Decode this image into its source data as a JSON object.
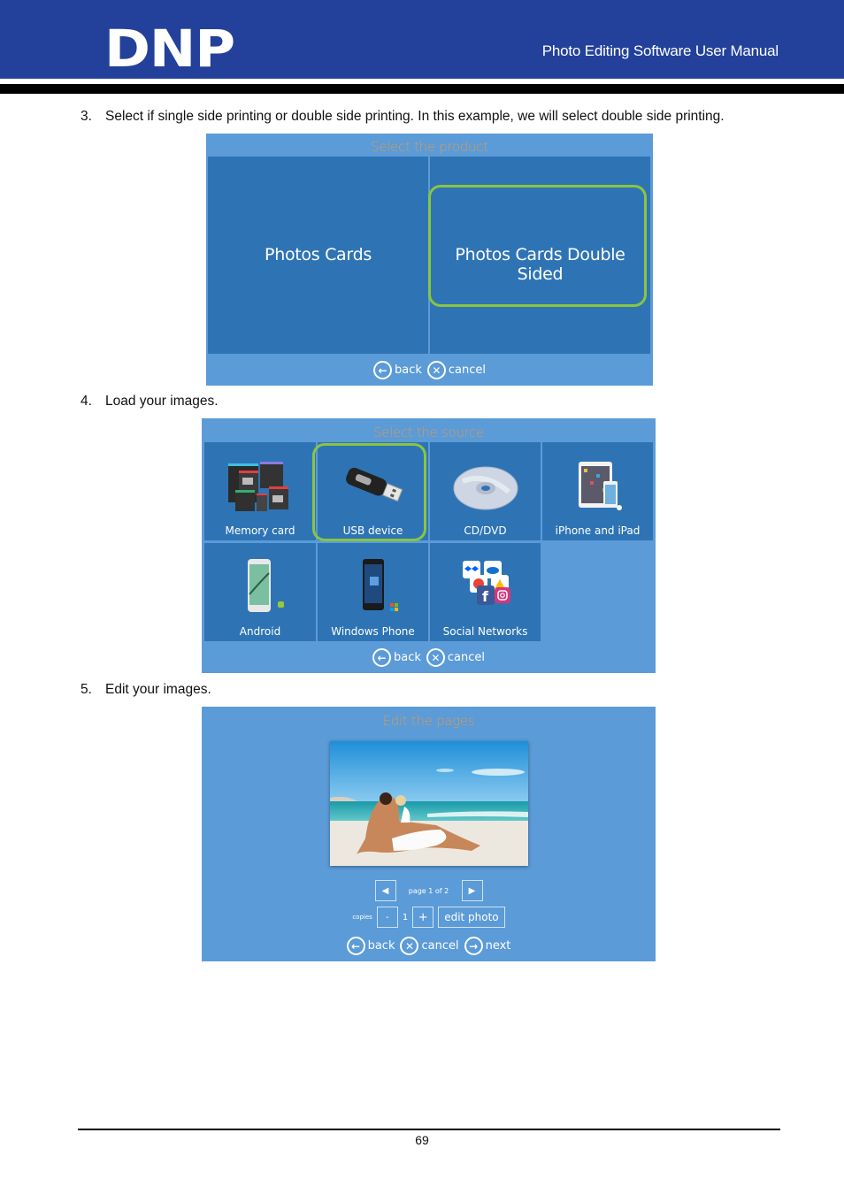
{
  "header": {
    "logo": "DNP",
    "title": "Photo Editing Software User Manual",
    "brand_color": "#23419a"
  },
  "steps": [
    {
      "num": "3.",
      "text": "Select if single side printing or double side printing. In this example, we will select double side printing."
    },
    {
      "num": "4.",
      "text": "Load your images."
    },
    {
      "num": "5.",
      "text": "Edit your images."
    }
  ],
  "screens": {
    "product": {
      "title": "Select the product",
      "options": [
        {
          "label": "Photos Cards",
          "selected": false
        },
        {
          "label": "Photos Cards Double Sided",
          "selected": true
        }
      ],
      "nav": {
        "back": "back",
        "cancel": "cancel"
      }
    },
    "source": {
      "title": "Select the source",
      "options": [
        {
          "label": "Memory card",
          "icon": "memory-card-icon",
          "selected": false
        },
        {
          "label": "USB device",
          "icon": "usb-drive-icon",
          "selected": true
        },
        {
          "label": "CD/DVD",
          "icon": "disc-icon",
          "selected": false
        },
        {
          "label": "iPhone and iPad",
          "icon": "ios-devices-icon",
          "selected": false
        },
        {
          "label": "Android",
          "icon": "android-phone-icon",
          "selected": false
        },
        {
          "label": "Windows Phone",
          "icon": "windows-phone-icon",
          "selected": false
        },
        {
          "label": "Social Networks",
          "icon": "social-networks-icon",
          "selected": false
        }
      ],
      "nav": {
        "back": "back",
        "cancel": "cancel"
      }
    },
    "edit": {
      "title": "Edit the pages",
      "page_text": "page 1 of 2",
      "copies_label": "copies",
      "copies_value": "1",
      "minus": "-",
      "plus": "+",
      "edit_photo": "edit photo",
      "nav": {
        "back": "back",
        "cancel": "cancel",
        "next": "next"
      }
    }
  },
  "colors": {
    "highlight": "#8ac53e",
    "screen_bg": "#5b9bd8",
    "tile_bg": "#2e74b5",
    "title_text": "#d49a5a"
  },
  "footer": {
    "page_number": "69"
  }
}
